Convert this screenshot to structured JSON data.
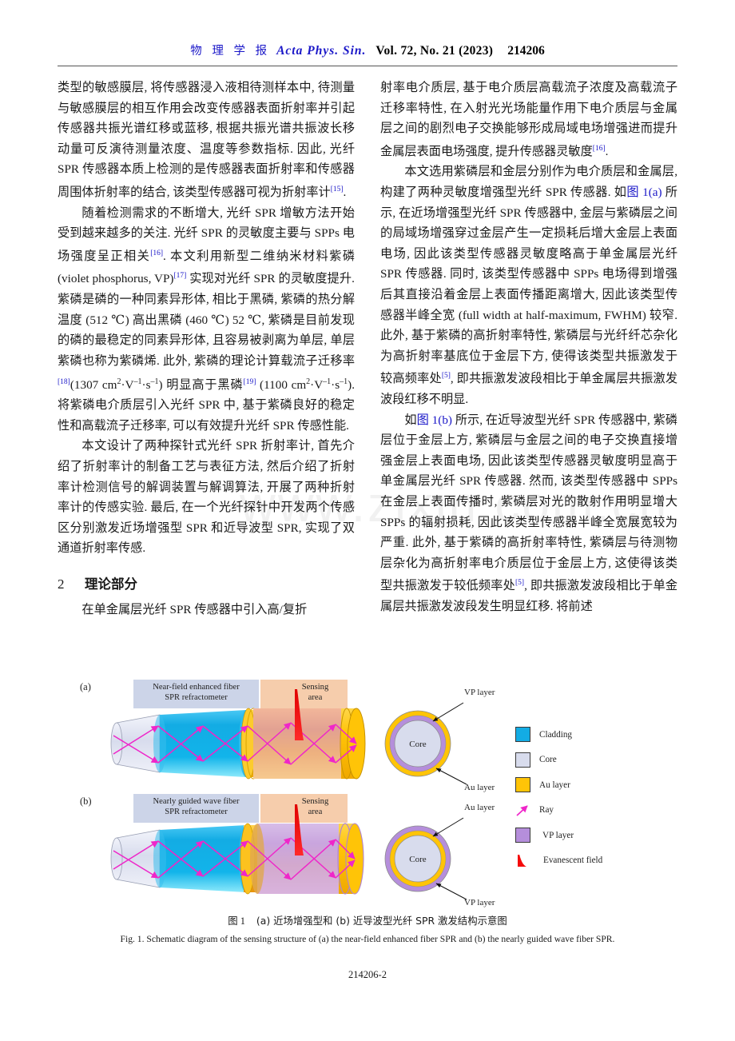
{
  "header": {
    "cn_journal": "物 理 学 报",
    "en_journal": "Acta  Phys.  Sin.",
    "volume_info": "Vol. 72, No. 21 (2023)",
    "article_id": "214206"
  },
  "footer": {
    "folio": "214206-2"
  },
  "watermark": {
    "text": "www.zixin.com.cn"
  },
  "left_column": {
    "para1_a": "类型的敏感膜层, 将传感器浸入液相待测样本中, 待测量与敏感膜层的相互作用会改变传感器表面折射率并引起传感器共振光谱红移或蓝移, 根据共振光谱共振波长移动量可反演待测量浓度、温度等参数指标. 因此, 光纤 SPR 传感器本质上检测的是传感器表面折射率和传感器周围体折射率的结合, 该类型传感器可视为折射率计",
    "para1_ref": "[15]",
    "para1_b": ".",
    "para2_a": "随着检测需求的不断增大, 光纤 SPR 增敏方法开始受到越来越多的关注. 光纤 SPR 的灵敏度主要与 SPPs 电场强度呈正相关",
    "para2_ref1": "[16]",
    "para2_b": ". 本文利用新型二维纳米材料紫磷 (violet phosphorus, VP)",
    "para2_ref2": "[17]",
    "para2_c": " 实现对光纤 SPR 的灵敏度提升. 紫磷是磷的一种同素异形体, 相比于黑磷, 紫磷的热分解温度 (512 ℃) 高出黑磷 (460 ℃) 52 ℃, 紫磷是目前发现的磷的最稳定的同素异形体, 且容易被剥离为单层, 单层紫磷也称为紫磷烯. 此外, 紫磷的理论计算载流子迁移率",
    "para2_ref3": "[18]",
    "para2_d": "(1307 cm",
    "para2_unit1_sup": "2",
    "para2_unit1_mid": "·V",
    "para2_unit1_sup2": "–1",
    "para2_unit1_mid2": "·s",
    "para2_unit1_sup3": "–1",
    "para2_e": ") 明显高于黑磷",
    "para2_ref4": "[19]",
    "para2_f": " (1100 cm",
    "para2_g": "). 将紫磷电介质层引入光纤 SPR 中, 基于紫磷良好的稳定性和高载流子迁移率, 可以有效提升光纤 SPR 传感性能.",
    "para3": "本文设计了两种探针式光纤 SPR 折射率计, 首先介绍了折射率计的制备工艺与表征方法, 然后介绍了折射率计检测信号的解调装置与解调算法, 开展了两种折射率计的传感实验. 最后, 在一个光纤探针中开发两个传感区分别激发近场增强型 SPR 和近导波型 SPR, 实现了双通道折射率传感.",
    "section_number": "2",
    "section_title": "理论部分",
    "para4": "在单金属层光纤 SPR 传感器中引入高/复折"
  },
  "right_column": {
    "para1_a": "射率电介质层, 基于电介质层高载流子浓度及高载流子迁移率特性, 在入射光光场能量作用下电介质层与金属层之间的剧烈电子交换能够形成局域电场增强进而提升金属层表面电场强度, 提升传感器灵敏度",
    "para1_ref": "[16]",
    "para1_b": ".",
    "para2_a": "本文选用紫磷层和金层分别作为电介质层和金属层, 构建了两种灵敏度增强型光纤 SPR 传感器. 如",
    "para2_xref1": "图 1(a)",
    "para2_b": " 所示, 在近场增强型光纤 SPR 传感器中, 金层与紫磷层之间的局域场增强穿过金层产生一定损耗后增大金层上表面电场, 因此该类型传感器灵敏度略高于单金属层光纤 SPR 传感器. 同时, 该类型传感器中 SPPs 电场得到增强后其直接沿着金层上表面传播距离增大, 因此该类型传感器半峰全宽 (full width at half-maximum, FWHM) 较窄. 此外, 基于紫磷的高折射率特性, 紫磷层与光纤纤芯杂化为高折射率基底位于金层下方, 使得该类型共振激发于较高频率处",
    "para2_ref2": "[5]",
    "para2_c": ", 即共振激发波段相比于单金属层共振激发波段红移不明显.",
    "para3_a": "如",
    "para3_xref": "图 1(b)",
    "para3_b": " 所示, 在近导波型光纤 SPR 传感器中, 紫磷层位于金层上方, 紫磷层与金层之间的电子交换直接增强金层上表面电场, 因此该类型传感器灵敏度明显高于单金属层光纤 SPR 传感器. 然而, 该类型传感器中 SPPs 在金层上表面传播时, 紫磷层对光的散射作用明显增大 SPPs 的辐射损耗, 因此该类型传感器半峰全宽展宽较为严重. 此外, 基于紫磷的高折射率特性, 紫磷层与待测物层杂化为高折射率电介质层位于金层上方, 这使得该类型共振激发于较低频率处",
    "para3_ref": "[5]",
    "para3_c": ", 即共振激发波段相比于单金属层共振激发波段发生明显红移. 将前述"
  },
  "figure": {
    "panel_a": {
      "tag": "(a)",
      "title_line1": "Near-field enhanced fiber",
      "title_line2": "SPR refractometer",
      "sensing_line1": "Sensing",
      "sensing_line2": "area",
      "cross_section": {
        "core_label": "Core",
        "outer_label": "VP layer",
        "inner_label": "Au layer"
      }
    },
    "panel_b": {
      "tag": "(b)",
      "title_line1": "Nearly guided wave fiber",
      "title_line2": "SPR refractometer",
      "sensing_line1": "Sensing",
      "sensing_line2": "area",
      "cross_section": {
        "core_label": "Core",
        "outer_label": "Au layer",
        "inner_label": "VP layer"
      }
    },
    "legend": [
      {
        "label": "Cladding",
        "icon": "swatch",
        "color": "#13ace4"
      },
      {
        "label": "Core",
        "icon": "swatch",
        "color": "#d8dced"
      },
      {
        "label": "Au layer",
        "icon": "swatch",
        "color": "#ffc407"
      },
      {
        "label": "Ray",
        "icon": "ray-arrow-icon",
        "color": "#ef26c9"
      },
      {
        "label": "VP layer",
        "icon": "swatch",
        "color": "#b58edb"
      },
      {
        "label": "Evanescent field",
        "icon": "evanescent-spike-icon",
        "color": "#f50b0b"
      }
    ],
    "caption_cn_figno": "图 1",
    "caption_cn": "(a) 近场增强型和 (b) 近导波型光纤 SPR 激发结构示意图",
    "caption_en": "Fig. 1. Schematic diagram of the sensing structure of (a) the near-field enhanced fiber SPR and (b) the nearly guided wave fiber SPR."
  },
  "colors": {
    "journal_blue": "#1a17c8",
    "xref_blue": "#1a17c8",
    "cladding_cyan": "#13ace4",
    "core_lavender": "#d8dced",
    "au_gold": "#ffc407",
    "vp_purple": "#b58edb",
    "ray_magenta": "#ef26c9",
    "evanescent_red": "#f50b0b",
    "header_blue_box": "#ccd4e8",
    "header_peach_box": "#f6cdac"
  }
}
